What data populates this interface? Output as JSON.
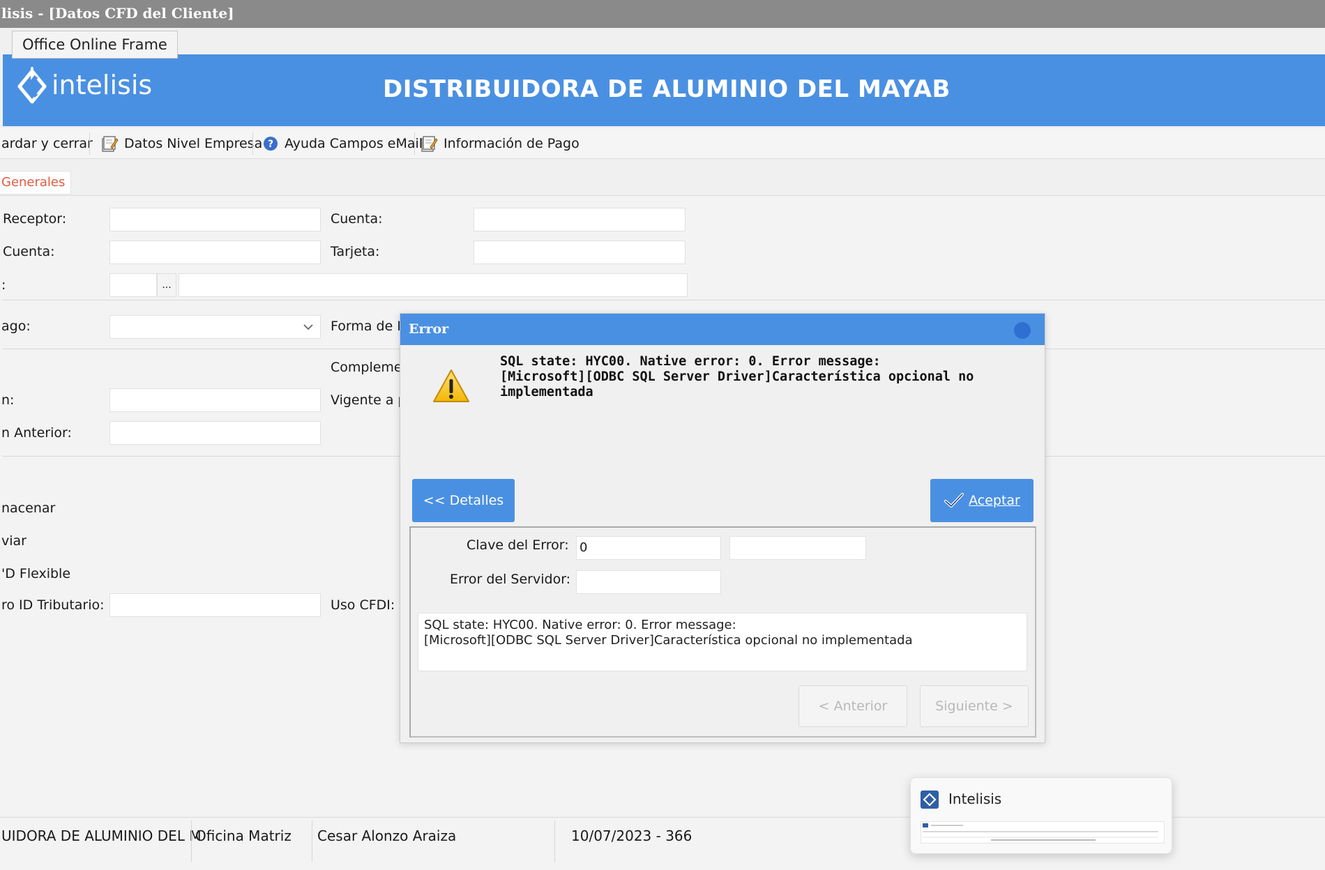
{
  "window": {
    "title": "lisis - [Datos CFD del Cliente]",
    "tooltip": "Office Online Frame"
  },
  "header": {
    "logo_text": "intelisis",
    "company": "DISTRIBUIDORA DE ALUMINIO DEL MAYAB",
    "background": "#4a90e2"
  },
  "toolbar": {
    "items": [
      {
        "label": "ardar y cerrar",
        "icon": "save-close"
      },
      {
        "label": "Datos Nivel Empresa",
        "icon": "document-edit-icon"
      },
      {
        "label": "Ayuda Campos eMail",
        "icon": "help-icon"
      },
      {
        "label": "Información de Pago",
        "icon": "document-edit-icon"
      }
    ]
  },
  "tabs": [
    {
      "label": "Generales",
      "color": "#e05a3c"
    }
  ],
  "form": {
    "labels": {
      "receptor": "Receptor:",
      "cuenta_left": "Cuenta:",
      "colon": ":",
      "pago": "ago:",
      "n": "n:",
      "n_anterior": "n Anterior:",
      "almacenar": "nacenar",
      "enviar": "viar",
      "cfd_flexible": "'D Flexible",
      "id_tributario": "ro ID Tributario:",
      "cuenta_right": "Cuenta:",
      "tarjeta": "Tarjeta:",
      "forma_pago": "Forma de Pa",
      "complemento": "Complemen",
      "vigente": "Vigente a pa",
      "uso_cfdi": "Uso CFDI:"
    },
    "ellipsis": "..."
  },
  "dialog": {
    "title": "Error",
    "message_lines": [
      "SQL state: HYC00. Native error: 0. Error message:",
      "[Microsoft][ODBC SQL Server Driver]Característica opcional no",
      "implementada"
    ],
    "details_button": "<< Detalles",
    "accept_button": "Aceptar",
    "clave_label": "Clave del Error:",
    "clave_value": "0",
    "servidor_label": "Error del Servidor:",
    "detail_text_lines": [
      "SQL state: HYC00. Native error: 0. Error message:",
      "[Microsoft][ODBC SQL Server Driver]Característica opcional no implementada"
    ],
    "prev_button": "< Anterior",
    "next_button": "Siguiente >"
  },
  "statusbar": {
    "company": "UIDORA DE ALUMINIO DEL M",
    "office": "Oficina Matriz",
    "user": "Cesar Alonzo Araiza",
    "date": "10/07/2023 - 366"
  },
  "taskbar_preview": {
    "title": "Intelisis"
  }
}
